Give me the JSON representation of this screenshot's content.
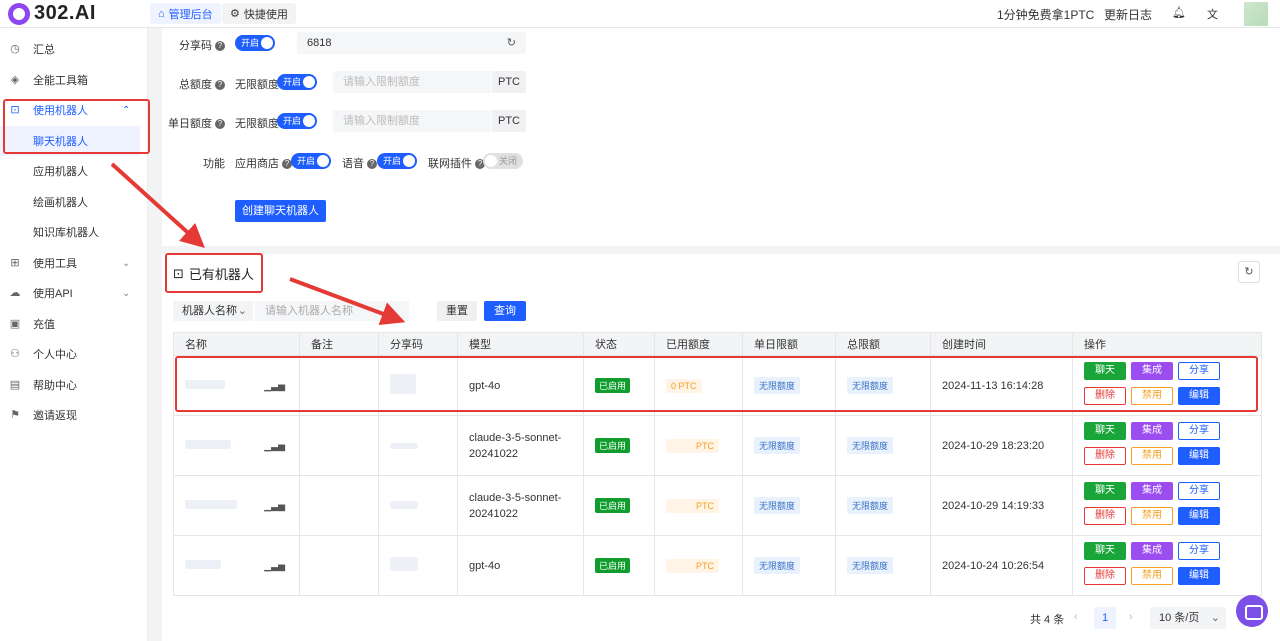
{
  "brand": {
    "name": "302.AI"
  },
  "topbar": {
    "tabs": [
      {
        "label": "管理后台",
        "icon": "home-icon"
      },
      {
        "label": "快捷使用",
        "icon": "gear-icon"
      }
    ],
    "promo": "1分钟免费拿1PTC",
    "changelog": "更新日志",
    "icons": [
      "bell-icon",
      "translate-icon"
    ]
  },
  "sidebar": {
    "items": [
      {
        "label": "汇总",
        "icon": "dashboard-icon"
      },
      {
        "label": "全能工具箱",
        "icon": "cube-icon"
      },
      {
        "label": "使用机器人",
        "icon": "robot-icon",
        "chevron": "⌃"
      },
      {
        "label": "聊天机器人"
      },
      {
        "label": "应用机器人"
      },
      {
        "label": "绘画机器人"
      },
      {
        "label": "知识库机器人"
      },
      {
        "label": "使用工具",
        "icon": "grid-icon",
        "chevron": "⌄"
      },
      {
        "label": "使用API",
        "icon": "cloud-icon",
        "chevron": "⌄"
      },
      {
        "label": "充值",
        "icon": "wallet-icon"
      },
      {
        "label": "个人中心",
        "icon": "user-icon"
      },
      {
        "label": "帮助中心",
        "icon": "book-icon"
      },
      {
        "label": "邀请返现",
        "icon": "invite-icon"
      }
    ]
  },
  "form": {
    "share_code": {
      "label": "分享码",
      "toggle": "开启",
      "value": "6818"
    },
    "total_quota": {
      "label": "总额度",
      "unlimited": "无限额度",
      "toggle": "开启",
      "placeholder": "请输入限制额度",
      "unit": "PTC"
    },
    "daily_quota": {
      "label": "单日额度",
      "unlimited": "无限额度",
      "toggle": "开启",
      "placeholder": "请输入限制额度",
      "unit": "PTC"
    },
    "features": {
      "label": "功能",
      "app_store": {
        "label": "应用商店",
        "toggle": "开启"
      },
      "voice": {
        "label": "语音",
        "toggle": "开启"
      },
      "web_plugin": {
        "label": "联网插件",
        "toggle": "关闭"
      }
    },
    "create_button": "创建聊天机器人"
  },
  "list": {
    "title": "已有机器人",
    "filter": {
      "select": "机器人名称",
      "placeholder": "请输入机器人名称",
      "reset": "重置",
      "query": "查询"
    },
    "columns": [
      "名称",
      "备注",
      "分享码",
      "模型",
      "状态",
      "已用额度",
      "单日限额",
      "总限额",
      "创建时间",
      "操作"
    ],
    "rows": [
      {
        "model": "gpt-4o",
        "status": "已启用",
        "used": "0 PTC",
        "daily": "无限额度",
        "total": "无限额度",
        "created": "2024-11-13 16:14:28"
      },
      {
        "model": "claude-3-5-sonnet-20241022",
        "status": "已启用",
        "used": "PTC",
        "daily": "无限额度",
        "total": "无限额度",
        "created": "2024-10-29 18:23:20"
      },
      {
        "model": "claude-3-5-sonnet-20241022",
        "status": "已启用",
        "used": "PTC",
        "daily": "无限额度",
        "total": "无限额度",
        "created": "2024-10-29 14:19:33"
      },
      {
        "model": "gpt-4o",
        "status": "已启用",
        "used": "PTC",
        "daily": "无限额度",
        "total": "无限额度",
        "created": "2024-10-24 10:26:54"
      }
    ],
    "actions": {
      "chat": "聊天",
      "integrate": "集成",
      "share": "分享",
      "delete": "删除",
      "disable": "禁用",
      "edit": "编辑"
    }
  },
  "pagination": {
    "total": "共 4 条",
    "prev": "‹",
    "page": "1",
    "next": "›",
    "page_size": "10 条/页"
  },
  "colors": {
    "primary": "#1e5eff",
    "brand": "#8e47f0",
    "annotation": "#e53935"
  }
}
